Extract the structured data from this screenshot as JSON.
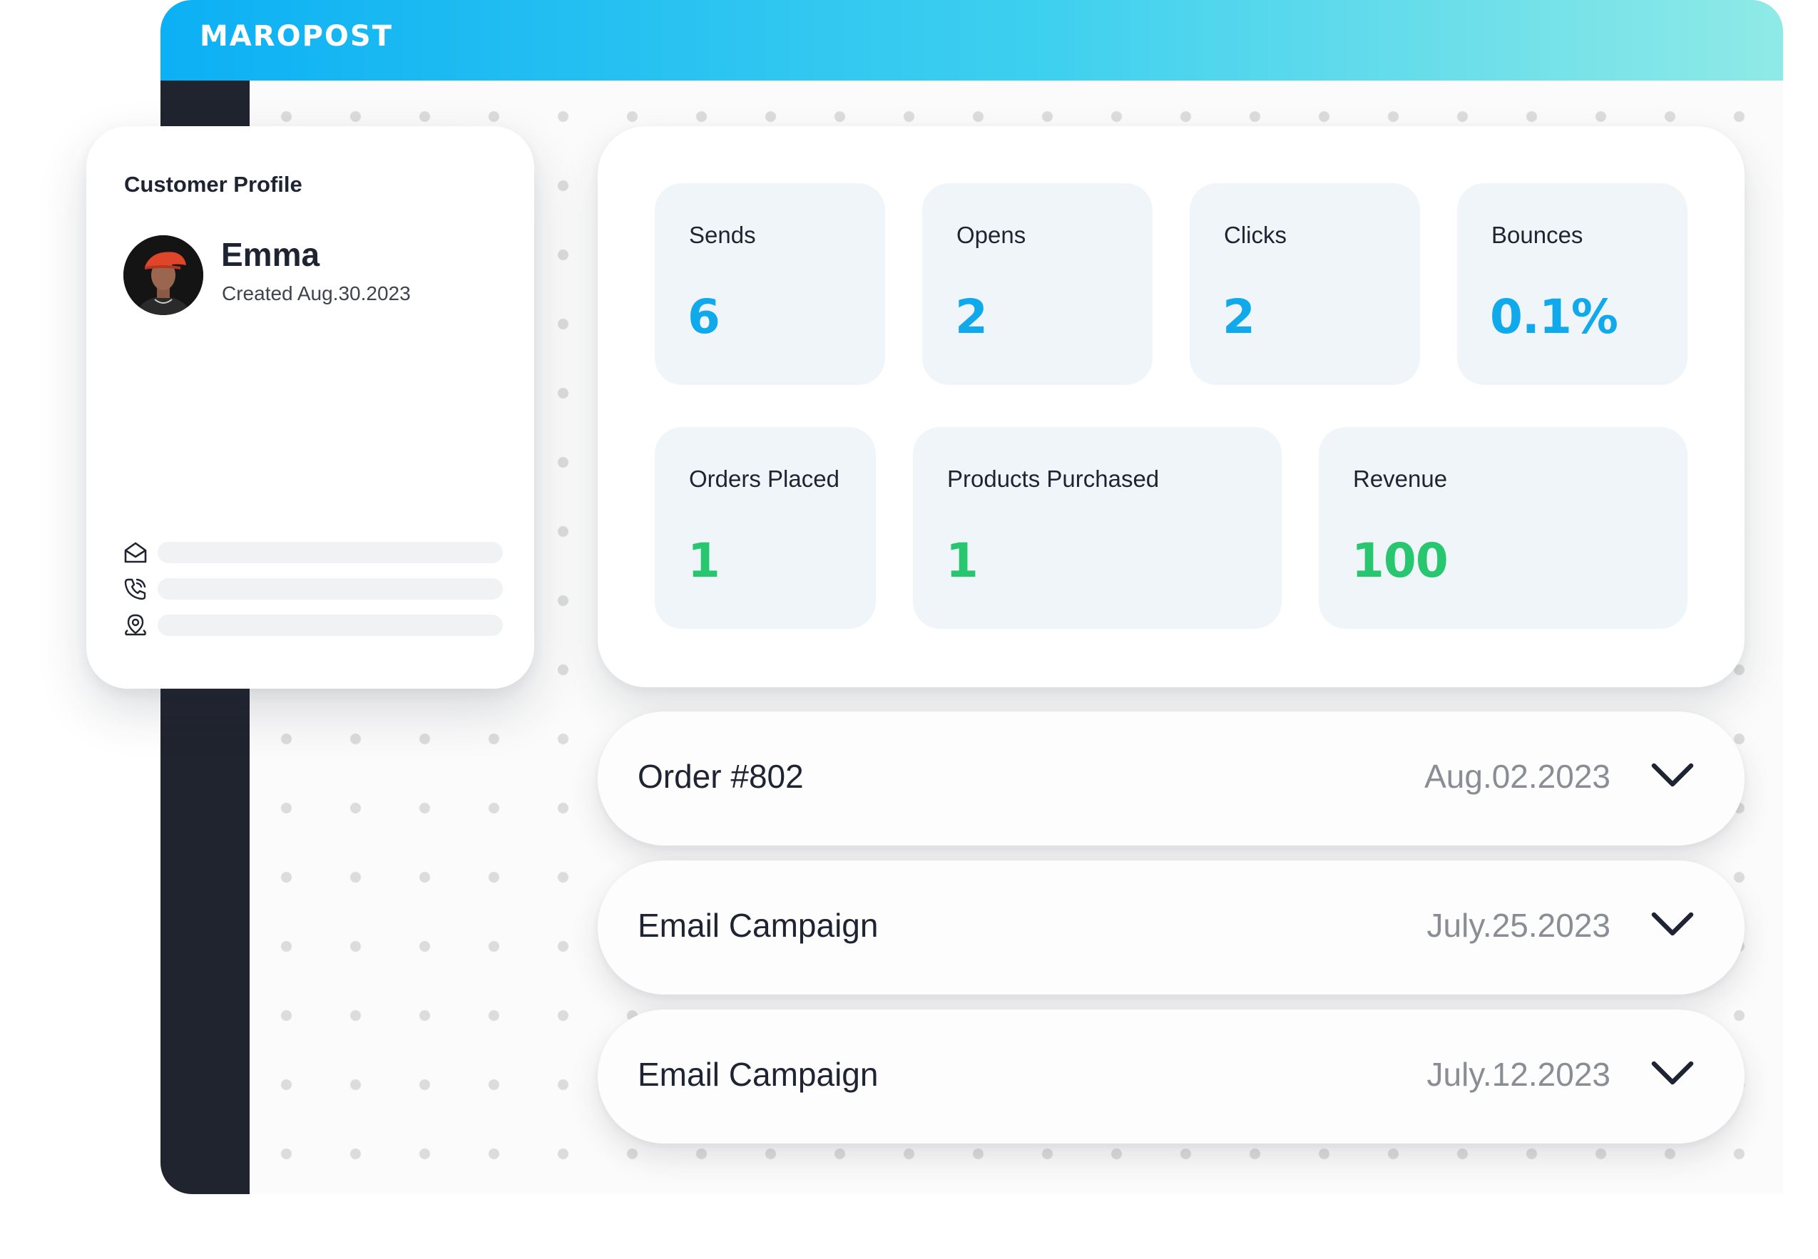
{
  "header": {
    "brand": "MAROPOST"
  },
  "profile": {
    "title": "Customer Profile",
    "name": "Emma",
    "created": "Created  Aug.30.2023",
    "contacts": [
      {
        "icon": "envelope-open-icon"
      },
      {
        "icon": "phone-icon"
      },
      {
        "icon": "location-pin-icon"
      }
    ]
  },
  "stats": {
    "engagement": [
      {
        "label": "Sends",
        "value": "6"
      },
      {
        "label": "Opens",
        "value": "2"
      },
      {
        "label": "Clicks",
        "value": "2"
      },
      {
        "label": "Bounces",
        "value": "0.1%"
      }
    ],
    "commerce": [
      {
        "label": "Orders Placed",
        "value": "1"
      },
      {
        "label": "Products Purchased",
        "value": "1"
      },
      {
        "label": "Revenue",
        "value": "100"
      }
    ]
  },
  "timeline": [
    {
      "title": "Order #802",
      "date": "Aug.02.2023",
      "icon": "chevron-down-icon"
    },
    {
      "title": "Email Campaign",
      "date": "July.25.2023",
      "icon": "chevron-down-icon"
    },
    {
      "title": "Email Campaign",
      "date": "July.12.2023",
      "icon": "chevron-down-icon"
    }
  ],
  "colors": {
    "accent_blue": "#0fa9ec",
    "accent_green": "#28c76f",
    "sidebar": "#20242f",
    "gradient_start": "#0cb0f4",
    "gradient_end": "#8feae6"
  }
}
